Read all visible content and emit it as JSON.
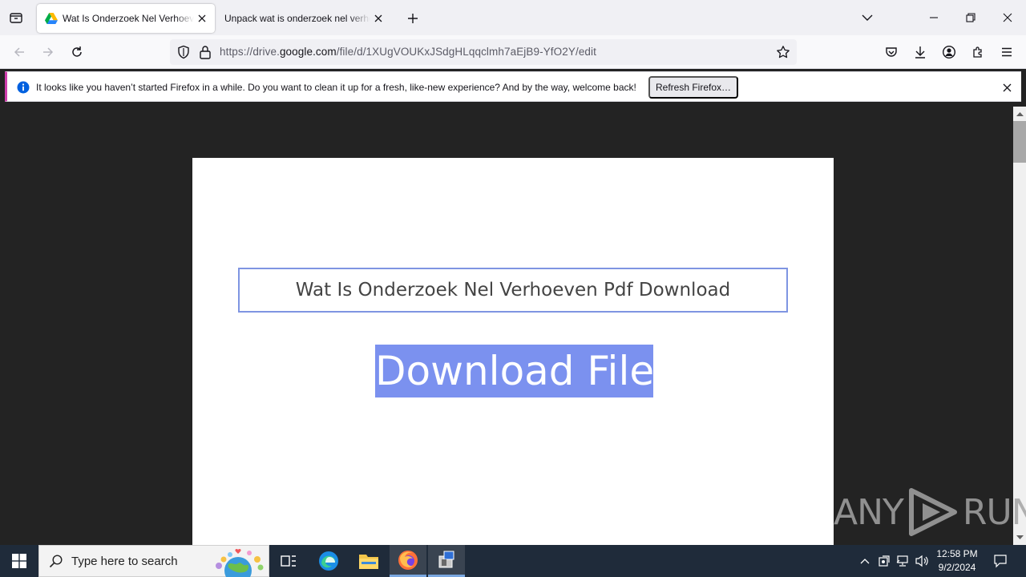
{
  "browser": {
    "tabs": [
      {
        "title": "Wat Is Onderzoek Nel Verhoeven Pdf Download",
        "active": true
      },
      {
        "title": "Unpack wat is onderzoek nel verhoeven",
        "active": false
      }
    ],
    "url": {
      "prefix": "https://drive.",
      "host": "google.com",
      "path": "/file/d/1XUgVOUKxJSdgHLqqclmh7aEjB9-YfO2Y/edit"
    }
  },
  "notification": {
    "message": "It looks like you haven’t started Firefox in a while. Do you want to clean it up for a fresh, like-new experience? And by the way, welcome back!",
    "button_label": "Refresh Firefox…"
  },
  "document": {
    "title": "Wat Is Onderzoek Nel Verhoeven Pdf Download",
    "download_label": "Download File"
  },
  "watermark": {
    "text_left": "ANY",
    "text_right": "RUN"
  },
  "taskbar": {
    "search_placeholder": "Type here to search",
    "time": "12:58 PM",
    "date": "9/2/2024"
  },
  "colors": {
    "accent": "#7b91ef",
    "title_border": "#7f95e2",
    "notification_stripe": "#cf3dac",
    "info_icon": "#0060df",
    "taskbar": "#1f2b3a",
    "page_background": "#232323"
  },
  "icons": [
    "tab-list-icon",
    "google-drive-icon",
    "close-icon",
    "plus-icon",
    "chevron-down-icon",
    "minimize-icon",
    "restore-icon",
    "back-icon",
    "forward-icon",
    "reload-icon",
    "shield-icon",
    "lock-icon",
    "star-icon",
    "pocket-icon",
    "download-icon",
    "account-icon",
    "extensions-icon",
    "menu-icon",
    "info-icon",
    "windows-start-icon",
    "search-icon",
    "task-view-icon",
    "edge-icon",
    "file-explorer-icon",
    "firefox-icon",
    "installer-icon",
    "tray-chevron-icon",
    "network-icon",
    "volume-icon",
    "notification-icon"
  ]
}
